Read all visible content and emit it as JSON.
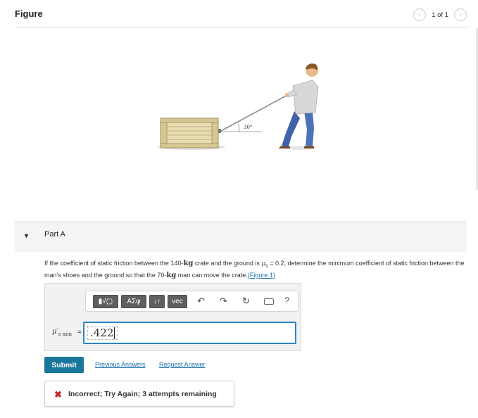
{
  "figure_panel": {
    "title": "Figure",
    "pager_text": "1 of 1",
    "prev_icon": "chevron-left-icon",
    "next_icon": "chevron-right-icon",
    "angle_label": "30°"
  },
  "part": {
    "label": "Part A",
    "question_pre": "If the coefficient of static friction between the 140-",
    "crate_unit": "kg",
    "question_mid": " crate and the ground is ",
    "mu": "μ",
    "mu_sub": "s",
    "question_mid2": " = 0.2, determine the minimum coefficient of static friction between the man's shoes and the ground so that the 70-",
    "man_unit": "kg",
    "question_post": " man can move the crate.",
    "figure_link": "(Figure 1)"
  },
  "answer": {
    "toolbar": {
      "template_btn": "▮√▢",
      "greek_btn": "ΑΣφ",
      "arrows_btn": "↓↑",
      "vec_btn": "vec",
      "undo_icon": "↶",
      "redo_icon": "↷",
      "reset_icon": "↻",
      "help_label": "?"
    },
    "variable_main": "μ′",
    "variable_sub": "s min",
    "equals": "=",
    "value": ".422"
  },
  "actions": {
    "submit_label": "Submit",
    "previous_answers_label": "Previous Answers",
    "request_answer_label": "Request Answer"
  },
  "feedback": {
    "icon": "✖",
    "text": "Incorrect; Try Again; 3 attempts remaining"
  },
  "colors": {
    "submit": "#1a779c",
    "link": "#1a6fb0",
    "input_border": "#2a84c6",
    "incorrect": "#c0272d"
  }
}
